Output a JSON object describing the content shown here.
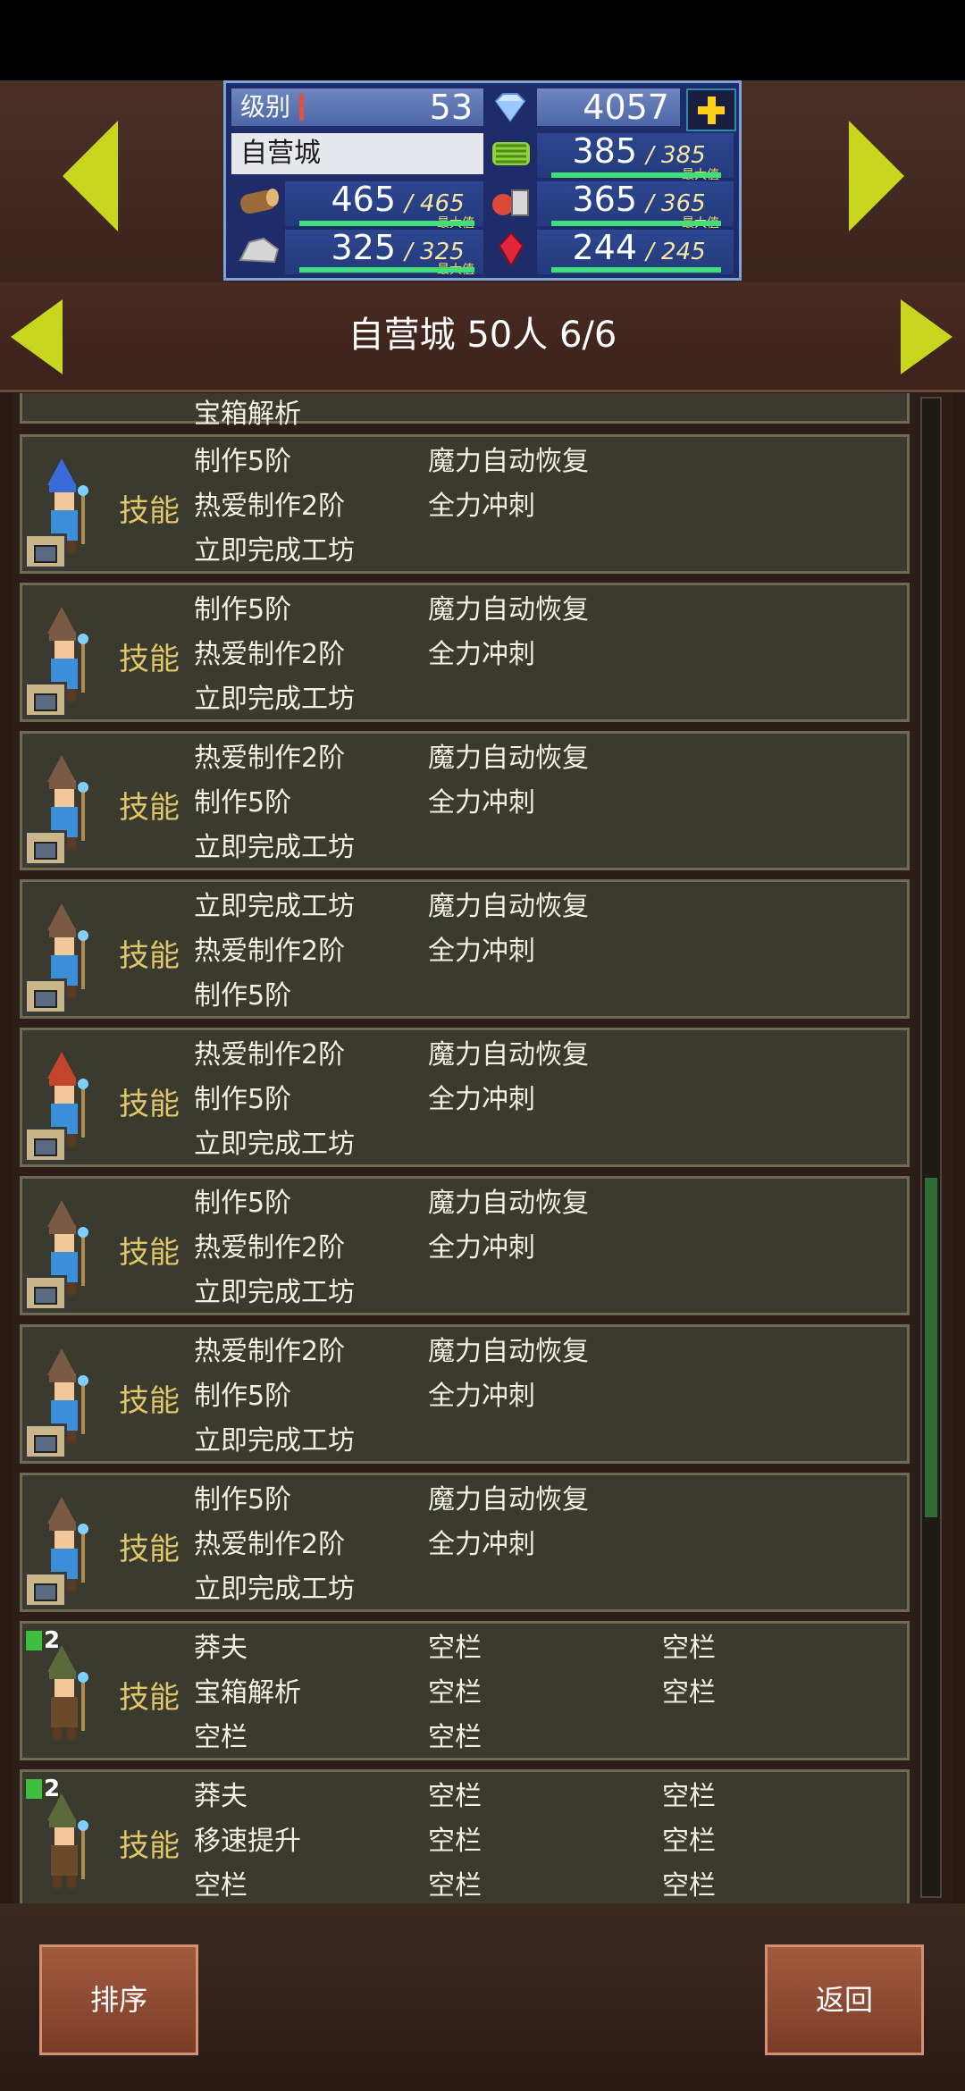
{
  "header": {
    "level_label": "级别",
    "level": "53",
    "gems": "4057",
    "castle_name": "自营城",
    "resources": [
      {
        "icon": "grass-icon",
        "value": "385",
        "max": "385",
        "cap_label": "最大值"
      },
      {
        "icon": "wood-icon",
        "value": "465",
        "max": "465",
        "cap_label": "最大值"
      },
      {
        "icon": "food-icon",
        "value": "365",
        "max": "365",
        "cap_label": "最大值"
      },
      {
        "icon": "stone-icon",
        "value": "325",
        "max": "325",
        "cap_label": "最大值"
      },
      {
        "icon": "ruby-icon",
        "value": "244",
        "max": "245",
        "cap_label": ""
      }
    ]
  },
  "title": "自营城  50人 6/6",
  "partial_row_text": "宝箱解析",
  "skill_label": "技能",
  "rows": [
    {
      "c1": [
        "制作5阶",
        "热爱制作2阶",
        "立即完成工坊"
      ],
      "c2": [
        "魔力自动恢复",
        "全力冲刺",
        ""
      ],
      "c3": [
        "",
        "",
        ""
      ],
      "badge": "workshop",
      "rank": "",
      "hat": "blue"
    },
    {
      "c1": [
        "制作5阶",
        "热爱制作2阶",
        "立即完成工坊"
      ],
      "c2": [
        "魔力自动恢复",
        "全力冲刺",
        ""
      ],
      "c3": [
        "",
        "",
        ""
      ],
      "badge": "workshop",
      "rank": "",
      "hat": "brown"
    },
    {
      "c1": [
        "热爱制作2阶",
        "制作5阶",
        "立即完成工坊"
      ],
      "c2": [
        "魔力自动恢复",
        "全力冲刺",
        ""
      ],
      "c3": [
        "",
        "",
        ""
      ],
      "badge": "workshop",
      "rank": "",
      "hat": "brown"
    },
    {
      "c1": [
        "立即完成工坊",
        "热爱制作2阶",
        "制作5阶"
      ],
      "c2": [
        "魔力自动恢复",
        "全力冲刺",
        ""
      ],
      "c3": [
        "",
        "",
        ""
      ],
      "badge": "workshop",
      "rank": "",
      "hat": "brown"
    },
    {
      "c1": [
        "热爱制作2阶",
        "制作5阶",
        "立即完成工坊"
      ],
      "c2": [
        "魔力自动恢复",
        "全力冲刺",
        ""
      ],
      "c3": [
        "",
        "",
        ""
      ],
      "badge": "workshop",
      "rank": "",
      "hat": "red"
    },
    {
      "c1": [
        "制作5阶",
        "热爱制作2阶",
        "立即完成工坊"
      ],
      "c2": [
        "魔力自动恢复",
        "全力冲刺",
        ""
      ],
      "c3": [
        "",
        "",
        ""
      ],
      "badge": "workshop",
      "rank": "",
      "hat": "brown"
    },
    {
      "c1": [
        "热爱制作2阶",
        "制作5阶",
        "立即完成工坊"
      ],
      "c2": [
        "魔力自动恢复",
        "全力冲刺",
        ""
      ],
      "c3": [
        "",
        "",
        ""
      ],
      "badge": "workshop",
      "rank": "",
      "hat": "brown"
    },
    {
      "c1": [
        "制作5阶",
        "热爱制作2阶",
        "立即完成工坊"
      ],
      "c2": [
        "魔力自动恢复",
        "全力冲刺",
        ""
      ],
      "c3": [
        "",
        "",
        ""
      ],
      "badge": "workshop",
      "rank": "",
      "hat": "brown"
    },
    {
      "c1": [
        "莽夫",
        "宝箱解析",
        "空栏"
      ],
      "c2": [
        "空栏",
        "空栏",
        "空栏"
      ],
      "c3": [
        "空栏",
        "空栏",
        ""
      ],
      "badge": "rank",
      "rank": "2",
      "hat": "green"
    },
    {
      "c1": [
        "莽夫",
        "移速提升",
        "空栏"
      ],
      "c2": [
        "空栏",
        "空栏",
        "空栏"
      ],
      "c3": [
        "空栏",
        "空栏",
        "空栏"
      ],
      "badge": "rank",
      "rank": "2",
      "hat": "green"
    }
  ],
  "buttons": {
    "sort": "排序",
    "back": "返回"
  },
  "colors": {
    "accent_arrow": "#c7d61f",
    "skill_label": "#e0c66b",
    "row_bg": "#3b3a2e"
  }
}
